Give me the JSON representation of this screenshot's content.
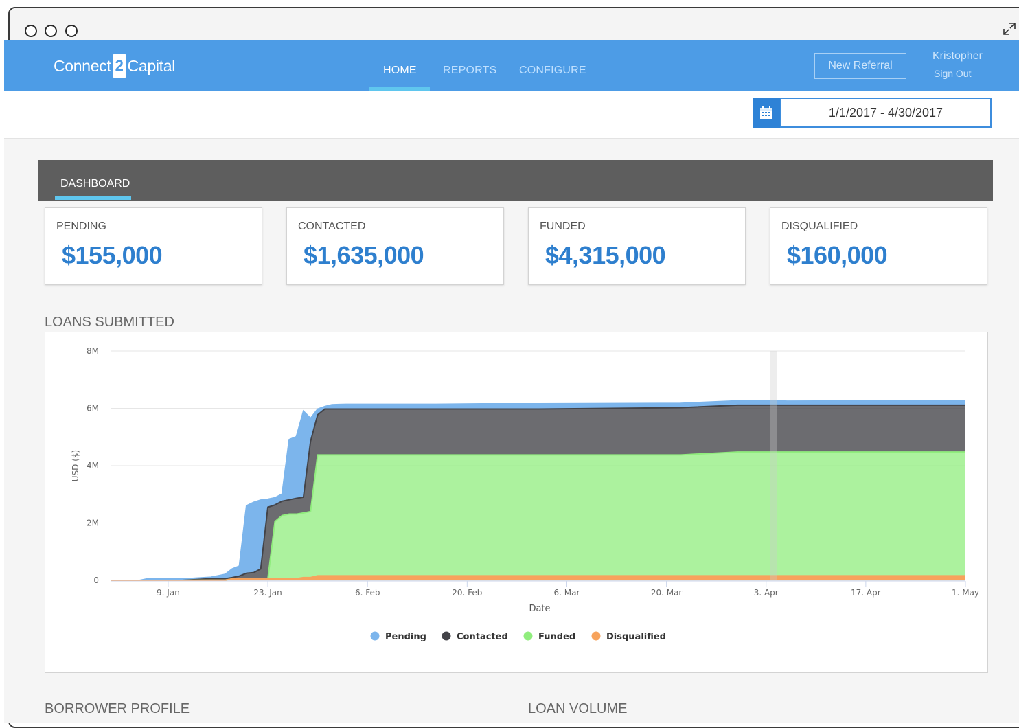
{
  "window": {
    "expand_icon": "expand-icon"
  },
  "nav": {
    "logo_left": "Connect",
    "logo_mid": "2",
    "logo_right": "Capital",
    "home": "HOME",
    "reports": "REPORTS",
    "configure": "CONFIGURE",
    "new_referral": "New Referral",
    "user_name": "Kristopher",
    "sign_out": "Sign Out"
  },
  "filter": {
    "calendar_icon": "calendar-icon",
    "date_range": "1/1/2017 - 4/30/2017"
  },
  "dashboard": {
    "tab": "DASHBOARD",
    "cards": [
      {
        "label": "PENDING",
        "value": "$155,000"
      },
      {
        "label": "CONTACTED",
        "value": "$1,635,000"
      },
      {
        "label": "FUNDED",
        "value": "$4,315,000"
      },
      {
        "label": "DISQUALIFIED",
        "value": "$160,000"
      }
    ],
    "loans_title": "LOANS SUBMITTED",
    "borrower_title": "BORROWER PROFILE",
    "volume_title": "LOAN VOLUME"
  },
  "colors": {
    "brand": "#4d9ce6",
    "pending": "#7cb5ec",
    "contacted": "#434348",
    "funded": "#90ed7d",
    "disqualified": "#f7a35c"
  },
  "chart_data": {
    "type": "area",
    "stacked": true,
    "title": "",
    "xlabel": "Date",
    "ylabel": "USD ($)",
    "ylim": [
      0,
      8000000
    ],
    "yticks": [
      {
        "v": 0,
        "label": "0"
      },
      {
        "v": 2000000,
        "label": "2M"
      },
      {
        "v": 4000000,
        "label": "4M"
      },
      {
        "v": 6000000,
        "label": "6M"
      },
      {
        "v": 8000000,
        "label": "8M"
      }
    ],
    "xlim": [
      0,
      120
    ],
    "xticks": [
      {
        "v": 8,
        "label": "9. Jan"
      },
      {
        "v": 22,
        "label": "23. Jan"
      },
      {
        "v": 36,
        "label": "6. Feb"
      },
      {
        "v": 50,
        "label": "20. Feb"
      },
      {
        "v": 64,
        "label": "6. Mar"
      },
      {
        "v": 78,
        "label": "20. Mar"
      },
      {
        "v": 92,
        "label": "3. Apr"
      },
      {
        "v": 106,
        "label": "17. Apr"
      },
      {
        "v": 120,
        "label": "1. May"
      }
    ],
    "crosshair_x": 93,
    "grid": true,
    "legend_position": "bottom",
    "x": [
      0,
      4,
      5,
      9,
      10,
      14,
      15,
      16,
      17,
      18,
      19,
      20,
      21,
      22,
      23,
      24,
      25,
      26,
      27,
      28,
      29,
      30,
      31,
      32,
      33,
      34,
      35,
      36,
      38,
      40,
      45,
      52,
      55,
      60,
      80,
      88,
      95,
      120
    ],
    "series": [
      {
        "name": "Disqualified",
        "values": [
          0,
          0,
          0,
          0,
          0,
          10000,
          10000,
          10000,
          50000,
          50000,
          50000,
          50000,
          50000,
          50000,
          50000,
          60000,
          60000,
          60000,
          100000,
          100000,
          160000,
          160000,
          160000,
          160000,
          160000,
          160000,
          160000,
          160000,
          160000,
          160000,
          160000,
          160000,
          160000,
          160000,
          160000,
          160000,
          160000,
          160000
        ]
      },
      {
        "name": "Funded",
        "values": [
          0,
          0,
          0,
          0,
          0,
          0,
          0,
          0,
          0,
          0,
          0,
          0,
          0,
          0,
          2000000,
          2200000,
          2250000,
          2250000,
          2250000,
          2300000,
          4215000,
          4215000,
          4215000,
          4215000,
          4215000,
          4215000,
          4215000,
          4215000,
          4215000,
          4215000,
          4215000,
          4215000,
          4215000,
          4215000,
          4215000,
          4315000,
          4315000,
          4315000
        ]
      },
      {
        "name": "Contacted",
        "values": [
          0,
          0,
          0,
          0,
          0,
          50000,
          50000,
          50000,
          50000,
          100000,
          200000,
          220000,
          350000,
          2500000,
          580000,
          500000,
          500000,
          550000,
          550000,
          2450000,
          1400000,
          1600000,
          1600000,
          1600000,
          1600000,
          1600000,
          1600000,
          1600000,
          1600000,
          1600000,
          1600000,
          1600000,
          1600000,
          1600000,
          1650000,
          1635000,
          1635000,
          1635000
        ]
      },
      {
        "name": "Pending",
        "values": [
          0,
          0,
          50000,
          50000,
          50000,
          50000,
          100000,
          150000,
          300000,
          350000,
          2350000,
          2450000,
          2400000,
          280000,
          250000,
          250000,
          2100000,
          2150000,
          3000000,
          800000,
          200000,
          90000,
          150000,
          160000,
          165000,
          165000,
          165000,
          165000,
          165000,
          165000,
          165000,
          180000,
          180000,
          180000,
          150000,
          150000,
          140000,
          155000
        ]
      }
    ]
  }
}
